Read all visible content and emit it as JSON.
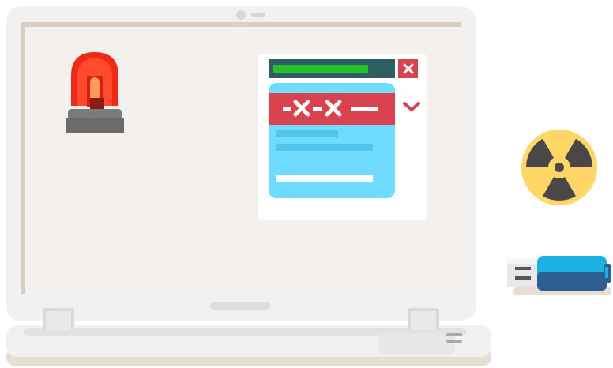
{
  "illustration": {
    "subject": "laptop-malware-alert",
    "icons": {
      "alarm": "alarm-beacon-icon",
      "radiation": "radiation-hazard-icon",
      "usb": "usb-flash-drive-icon",
      "error_window": "error-popup-window",
      "close": "close-icon",
      "dropdown": "chevron-down-icon"
    },
    "error_banner_text": "-X-X—",
    "progress_fraction": 0.81,
    "colors": {
      "laptop_body": "#f1f1f1",
      "screen_background": "#f4f0ee",
      "screen_frame": "#d9cfc0",
      "popup_bg": "#ffffff",
      "popup_panel": "#6fdcff",
      "error_red": "#d9434f",
      "progress_track": "#2f5e63",
      "progress_fill": "#25c327",
      "alarm_red": "#ef2a18",
      "alarm_base": "#6b6b6b",
      "radiation_yellow": "#ffd766",
      "radiation_dark": "#4a4748",
      "usb_blue": "#1bb1e2",
      "usb_dark_blue": "#2c5f94",
      "shadow": "#e5dfd2"
    }
  }
}
